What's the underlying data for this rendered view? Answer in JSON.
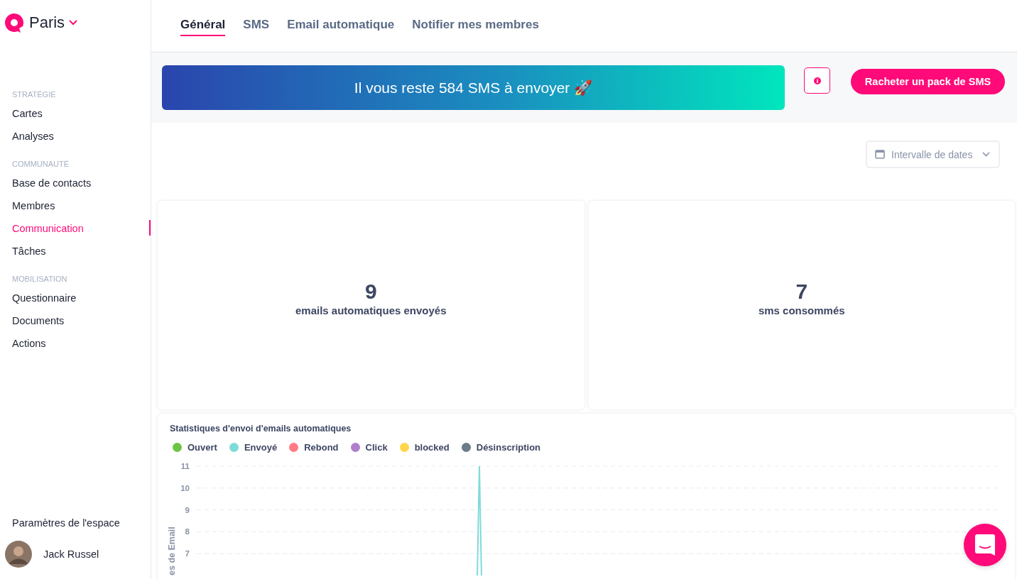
{
  "workspace": {
    "name": "Paris"
  },
  "sidebar": {
    "sections": [
      {
        "heading": "STRATÉGIE",
        "items": [
          {
            "label": "Cartes",
            "selected": false
          },
          {
            "label": "Analyses",
            "selected": false
          }
        ]
      },
      {
        "heading": "COMMUNAUTÉ",
        "items": [
          {
            "label": "Base de contacts",
            "selected": false
          },
          {
            "label": "Membres",
            "selected": false
          },
          {
            "label": "Communication",
            "selected": true
          },
          {
            "label": "Tâches",
            "selected": false
          }
        ]
      },
      {
        "heading": "MOBILISATION",
        "items": [
          {
            "label": "Questionnaire",
            "selected": false
          },
          {
            "label": "Documents",
            "selected": false
          },
          {
            "label": "Actions",
            "selected": false
          }
        ]
      }
    ],
    "settings": "Paramètres de l'espace",
    "user": {
      "name": "Jack Russel"
    }
  },
  "tabs": [
    {
      "label": "Général",
      "selected": true
    },
    {
      "label": "SMS",
      "selected": false
    },
    {
      "label": "Email automatique",
      "selected": false
    },
    {
      "label": "Notifier mes membres",
      "selected": false
    }
  ],
  "banner": {
    "text": "Il vous reste 584 SMS à envoyer 🚀"
  },
  "buy_button": "Racheter un pack de SMS",
  "date_filter": {
    "placeholder": "Intervalle de dates"
  },
  "stats": [
    {
      "value": "9",
      "label": "emails automatiques envoyés"
    },
    {
      "value": "7",
      "label": "sms consommés"
    }
  ],
  "chart": {
    "title": "Statistiques d'envoi d'emails automatiques",
    "legend": [
      {
        "label": "Ouvert",
        "color": "#6cc644"
      },
      {
        "label": "Envoyé",
        "color": "#7fdbd9"
      },
      {
        "label": "Rebond",
        "color": "#ff7b84"
      },
      {
        "label": "Click",
        "color": "#b07fcb"
      },
      {
        "label": "blocked",
        "color": "#ffd54a"
      },
      {
        "label": "Désinscription",
        "color": "#6c7c88"
      }
    ],
    "y_label": "es de Email",
    "y_ticks": [
      "11",
      "10",
      "9",
      "8",
      "7"
    ]
  }
}
